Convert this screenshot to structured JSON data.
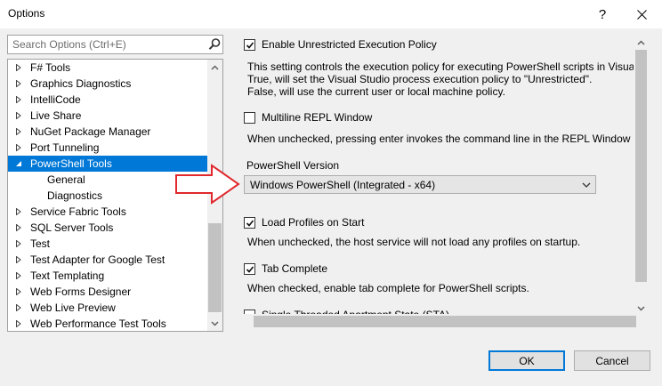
{
  "window": {
    "title": "Options",
    "help_label": "?"
  },
  "search": {
    "placeholder": "Search Options (Ctrl+E)"
  },
  "tree": {
    "items": [
      {
        "label": "F# Tools"
      },
      {
        "label": "Graphics Diagnostics"
      },
      {
        "label": "IntelliCode"
      },
      {
        "label": "Live Share"
      },
      {
        "label": "NuGet Package Manager"
      },
      {
        "label": "Port Tunneling"
      },
      {
        "label": "PowerShell Tools"
      },
      {
        "label": "General"
      },
      {
        "label": "Diagnostics"
      },
      {
        "label": "Service Fabric Tools"
      },
      {
        "label": "SQL Server Tools"
      },
      {
        "label": "Test"
      },
      {
        "label": "Test Adapter for Google Test"
      },
      {
        "label": "Text Templating"
      },
      {
        "label": "Web Forms Designer"
      },
      {
        "label": "Web Live Preview"
      },
      {
        "label": "Web Performance Test Tools"
      }
    ]
  },
  "settings": {
    "unrestricted": {
      "label": "Enable Unrestricted Execution Policy",
      "checked": true,
      "desc": [
        "This setting controls the execution policy for executing PowerShell scripts in Visual",
        "True, will set the Visual Studio process execution policy to \"Unrestricted\".",
        "False, will use the current user or local machine policy."
      ]
    },
    "multiline": {
      "label": "Multiline REPL Window",
      "checked": false,
      "desc": "When unchecked, pressing enter invokes the command line in the REPL Window ra"
    },
    "version": {
      "label": "PowerShell Version",
      "value": "Windows PowerShell (Integrated - x64)"
    },
    "profiles": {
      "label": "Load Profiles on Start",
      "checked": true,
      "desc": "When unchecked, the host service will not load any profiles on startup."
    },
    "tabcomplete": {
      "label": "Tab Complete",
      "checked": true,
      "desc": "When checked, enable tab complete for PowerShell scripts."
    },
    "sta": {
      "label": "Single Threaded Apartment State (STA)",
      "checked": false
    }
  },
  "buttons": {
    "ok": "OK",
    "cancel": "Cancel"
  },
  "colors": {
    "selection": "#0078d7",
    "annotation_arrow": "#e0282d"
  }
}
